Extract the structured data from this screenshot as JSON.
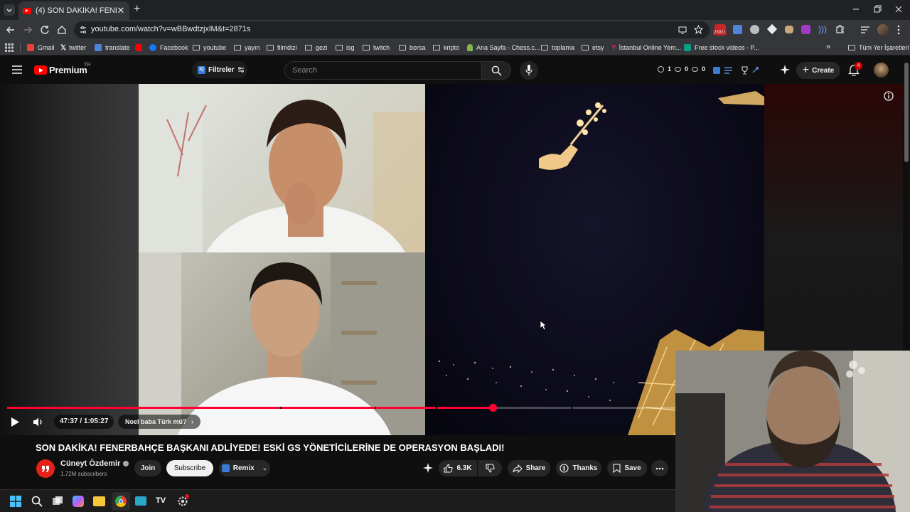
{
  "browser": {
    "tab_title": "(4) SON DAKİKA! FENERBAHÇE",
    "url": "youtube.com/watch?v=wBBwdtzjxlM&t=2871s",
    "ext_badge": "23921",
    "bookmarks": [
      {
        "label": "Gmail"
      },
      {
        "label": "twitter"
      },
      {
        "label": "translate"
      },
      {
        "label": ""
      },
      {
        "label": "Facebook"
      },
      {
        "label": "youtube"
      },
      {
        "label": "yayın"
      },
      {
        "label": "filmdizi"
      },
      {
        "label": "gezi"
      },
      {
        "label": "isg"
      },
      {
        "label": "twitch"
      },
      {
        "label": "borsa"
      },
      {
        "label": "kripto"
      },
      {
        "label": "Ana Sayfa - Chess.c..."
      },
      {
        "label": "toplama"
      },
      {
        "label": "etsy"
      },
      {
        "label": "İstanbul Online Yem..."
      },
      {
        "label": "Free stock videos - P..."
      }
    ],
    "all_bookmarks": "Tüm Yer İşaretleri"
  },
  "youtube": {
    "logo_text": "Premium",
    "logo_sup": "TR",
    "filter_label": "Filtreler",
    "search_placeholder": "Search",
    "counters": [
      "1",
      "0",
      "0"
    ],
    "create_label": "Create",
    "notif_count": "4"
  },
  "player": {
    "progress": 0.727,
    "time": "47:37 / 1:05:27",
    "chapter": "Noel baba Türk mü?"
  },
  "video": {
    "title": "SON DAKİKA! FENERBAHÇE BAŞKANI ADLİYEDE! ESKİ GS YÖNETİCİLERİNE DE OPERASYON BAŞLADI!",
    "channel": "Cüneyt Özdemir",
    "subscribers": "1.72M subscribers",
    "join": "Join",
    "subscribe": "Subscribe",
    "remix": "Remix",
    "likes": "6.3K",
    "share": "Share",
    "thanks": "Thanks",
    "save": "Save"
  },
  "colors": {
    "brand": "#ff0000",
    "progress": "#ff0033",
    "bg": "#0f0f0f"
  }
}
